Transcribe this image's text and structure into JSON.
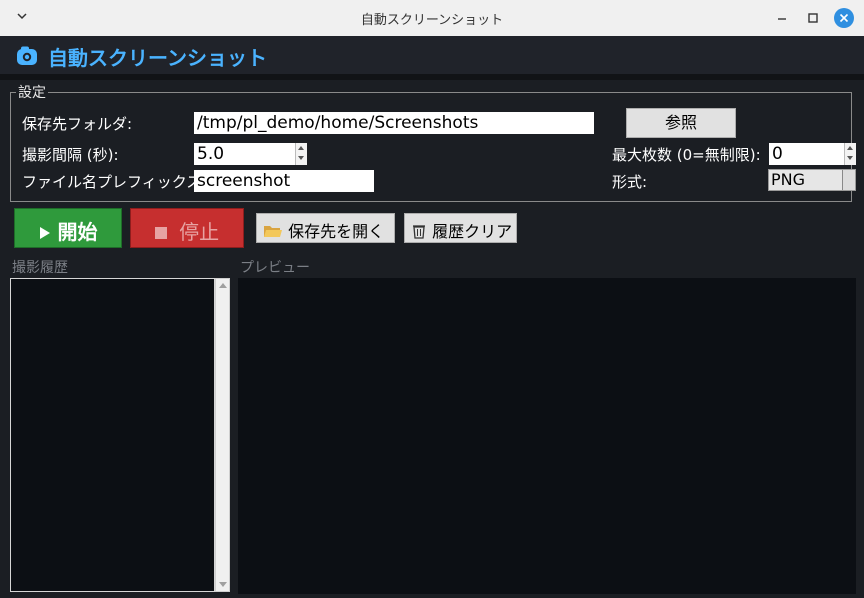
{
  "window": {
    "title": "自動スクリーンショット"
  },
  "app": {
    "title": "自動スクリーンショット"
  },
  "settings": {
    "legend": "設定",
    "folder_label": "保存先フォルダ:",
    "folder_value": "/tmp/pl_demo/home/Screenshots",
    "browse_label": "参照",
    "interval_label": "撮影間隔 (秒):",
    "interval_value": "5.0",
    "max_label": "最大枚数 (0=無制限):",
    "max_value": "0",
    "prefix_label": "ファイル名プレフィックス:",
    "prefix_value": "screenshot",
    "format_label": "形式:",
    "format_value": "PNG"
  },
  "actions": {
    "start_label": "開始",
    "stop_label": "停止",
    "open_folder_label": "保存先を開く",
    "clear_history_label": "履歴クリア"
  },
  "panels": {
    "history_label": "撮影履歴",
    "preview_label": "プレビュー"
  },
  "colors": {
    "accent": "#4ab3ff",
    "start": "#2f9a3c",
    "stop": "#c62f2f",
    "close_button": "#2f8fe0"
  }
}
